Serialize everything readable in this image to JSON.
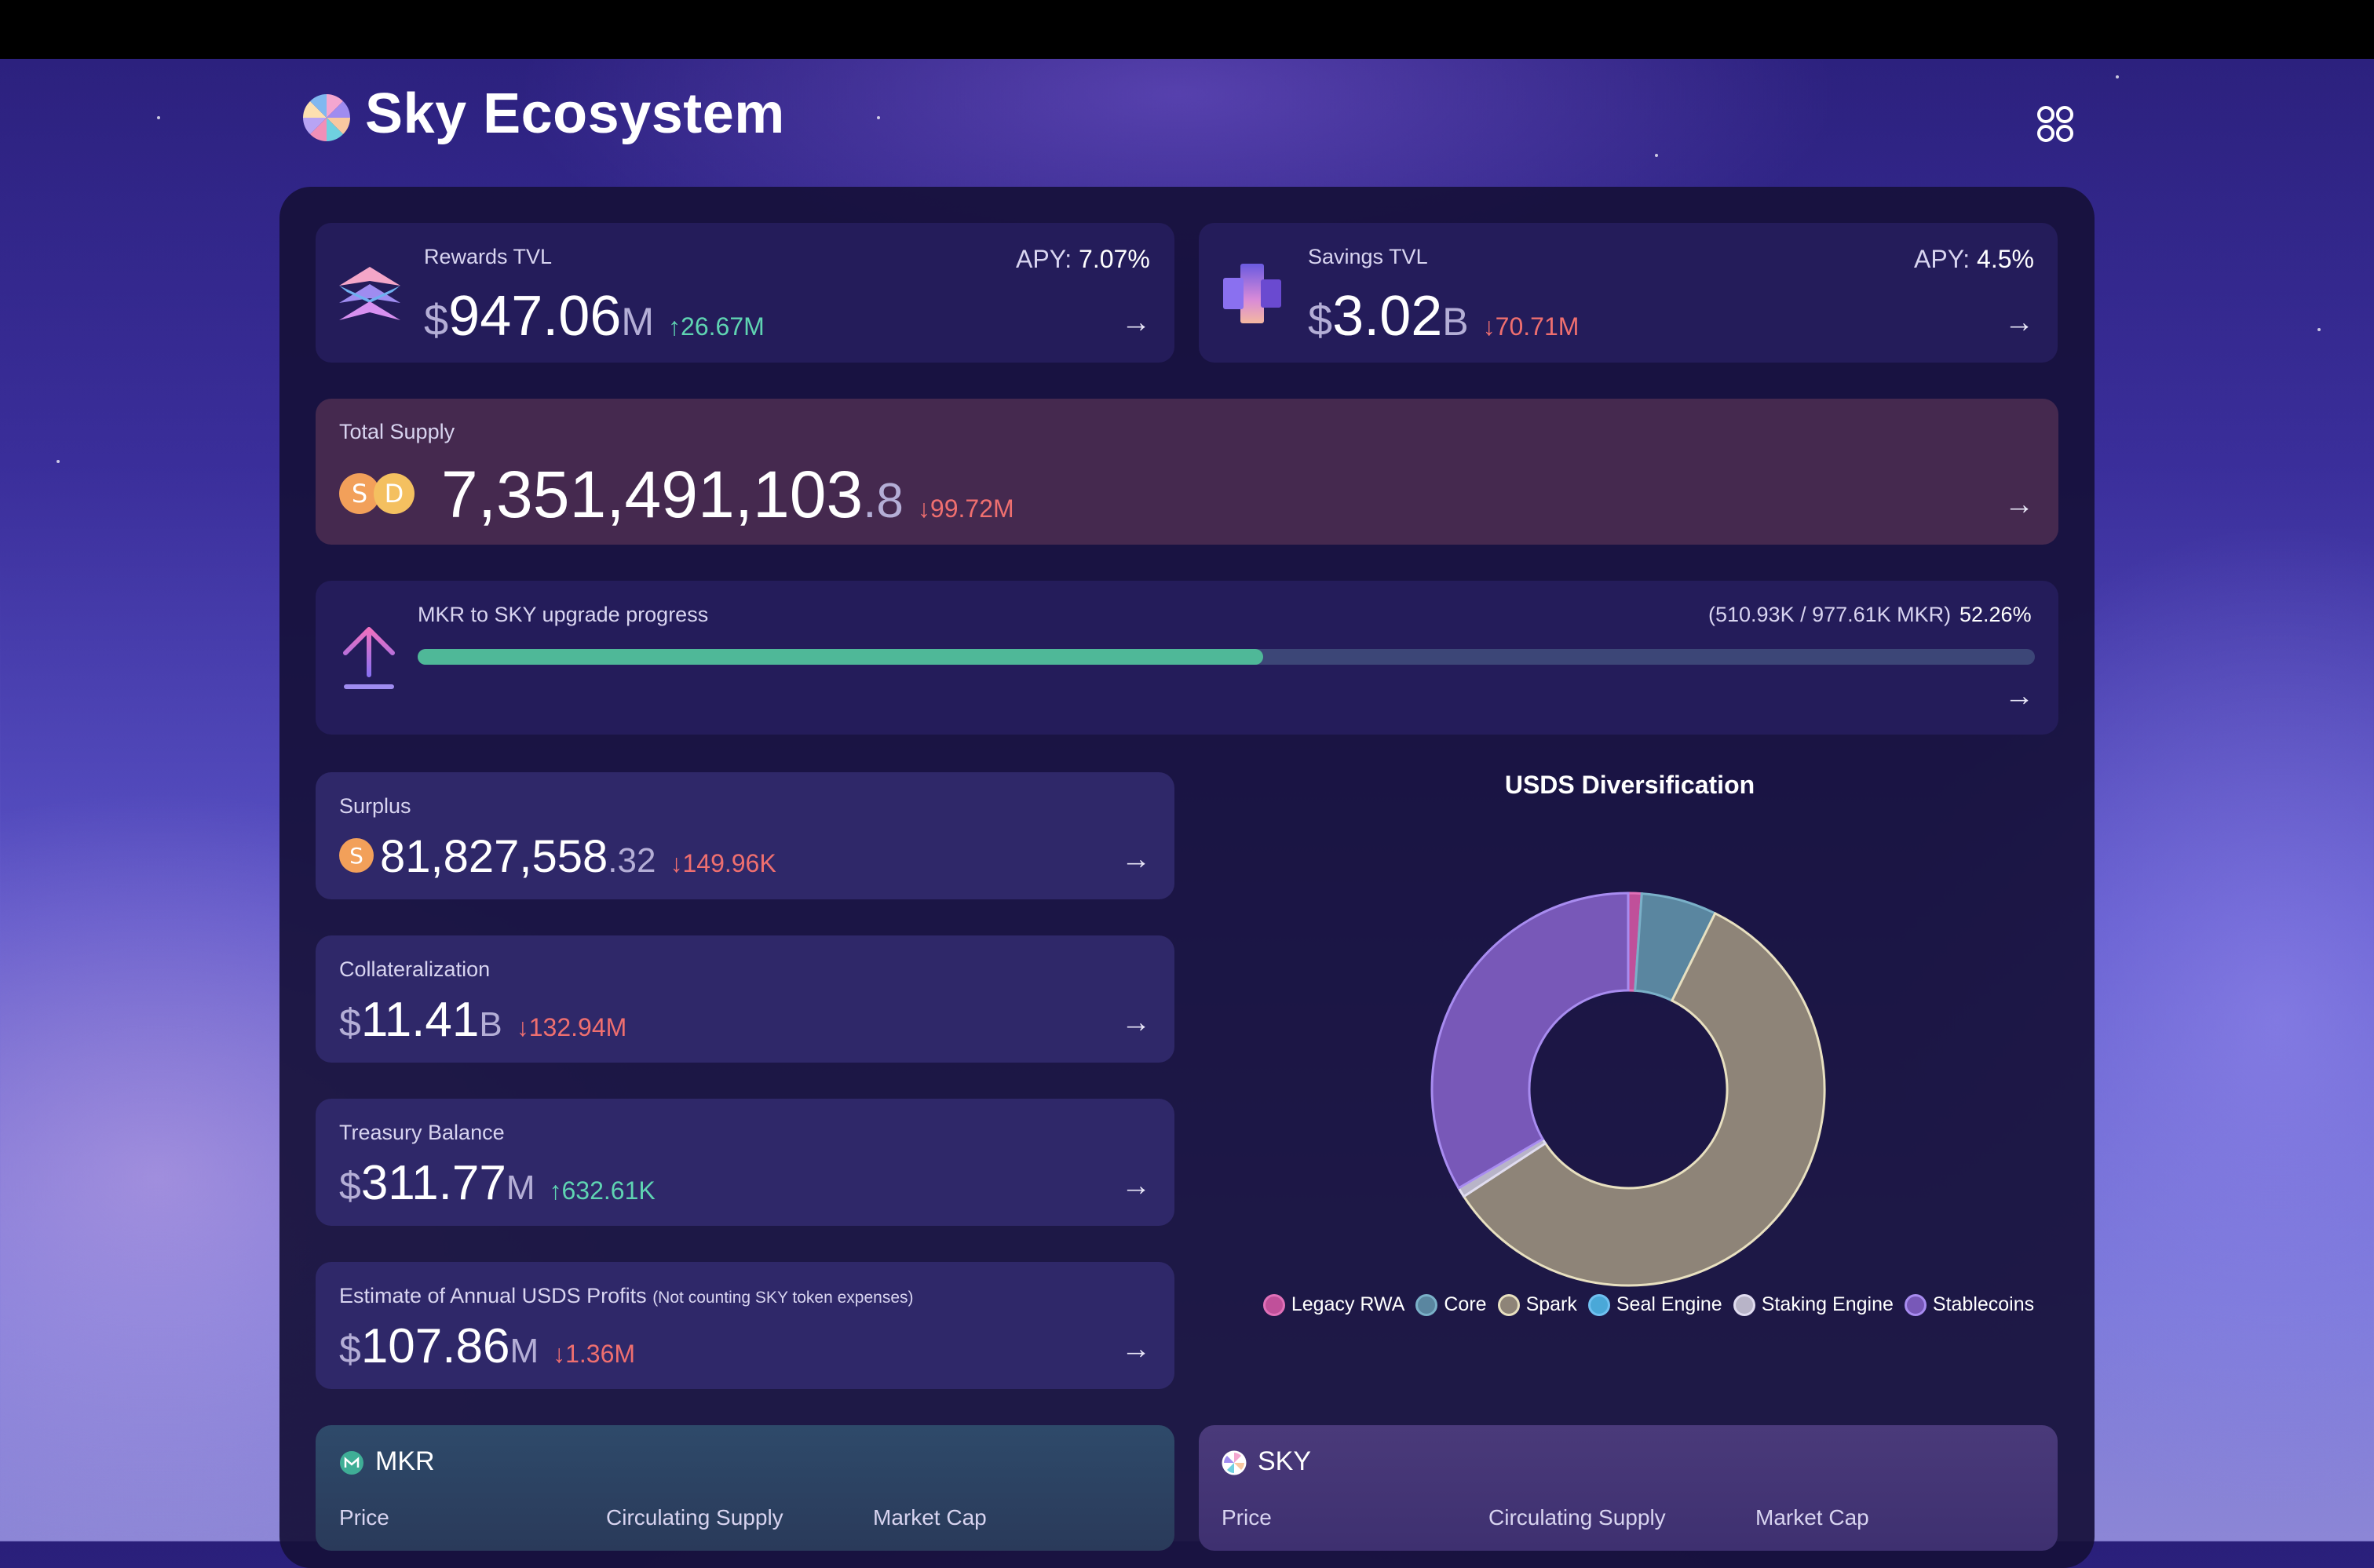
{
  "header": {
    "title": "Sky Ecosystem",
    "logo_icon": "sky-pinwheel-logo",
    "menu_icon": "grid-menu-icon"
  },
  "rewards": {
    "label": "Rewards TVL",
    "currency": "$",
    "value": "947.06",
    "unit": "M",
    "delta": "↑26.67M",
    "apy_key": "APY:",
    "apy_value": "7.07%"
  },
  "savings": {
    "label": "Savings TVL",
    "currency": "$",
    "value": "3.02",
    "unit": "B",
    "delta": "↓70.71M",
    "apy_key": "APY:",
    "apy_value": "4.5%"
  },
  "supply": {
    "label": "Total Supply",
    "value": "7,351,491,103",
    "decimals": ".8",
    "delta": "↓99.72M"
  },
  "upgrade": {
    "label": "MKR to SKY upgrade progress",
    "detail": "(510.93K / 977.61K MKR)",
    "percent_text": "52.26%",
    "progress": 0.5226
  },
  "surplus": {
    "label": "Surplus",
    "value": "81,827,558",
    "decimals": ".32",
    "delta": "↓149.96K"
  },
  "collateral": {
    "label": "Collateralization",
    "currency": "$",
    "value": "11.41",
    "unit": "B",
    "delta": "↓132.94M"
  },
  "treasury": {
    "label": "Treasury Balance",
    "currency": "$",
    "value": "311.77",
    "unit": "M",
    "delta": "↑632.61K"
  },
  "profits": {
    "label": "Estimate of Annual USDS Profits",
    "note": "(Not counting SKY token expenses)",
    "currency": "$",
    "value": "107.86",
    "unit": "M",
    "delta": "↓1.36M"
  },
  "arrow": "→",
  "diversification": {
    "title": "USDS Diversification",
    "legend": [
      "Legacy RWA",
      "Core",
      "Spark",
      "Seal Engine",
      "Staking Engine",
      "Stablecoins"
    ]
  },
  "mkr": {
    "name": "MKR",
    "col1": "Price",
    "col2": "Circulating Supply",
    "col3": "Market Cap"
  },
  "sky": {
    "name": "SKY",
    "col1": "Price",
    "col2": "Circulating Supply",
    "col3": "Market Cap"
  },
  "colors": {
    "legacy_rwa": "#c0509a",
    "core": "#5a86a0",
    "spark": "#8e8478",
    "seal_engine": "#4aa8d8",
    "staking_engine": "#b8b4c8",
    "stablecoins": "#7858b8"
  },
  "chart_data": {
    "type": "pie",
    "title": "USDS Diversification",
    "categories": [
      "Legacy RWA",
      "Core",
      "Spark",
      "Seal Engine",
      "Staking Engine",
      "Stablecoins"
    ],
    "values": [
      1.1,
      6.2,
      58.5,
      0,
      0.8,
      33.4
    ],
    "donut": true,
    "legend": "bottom"
  }
}
